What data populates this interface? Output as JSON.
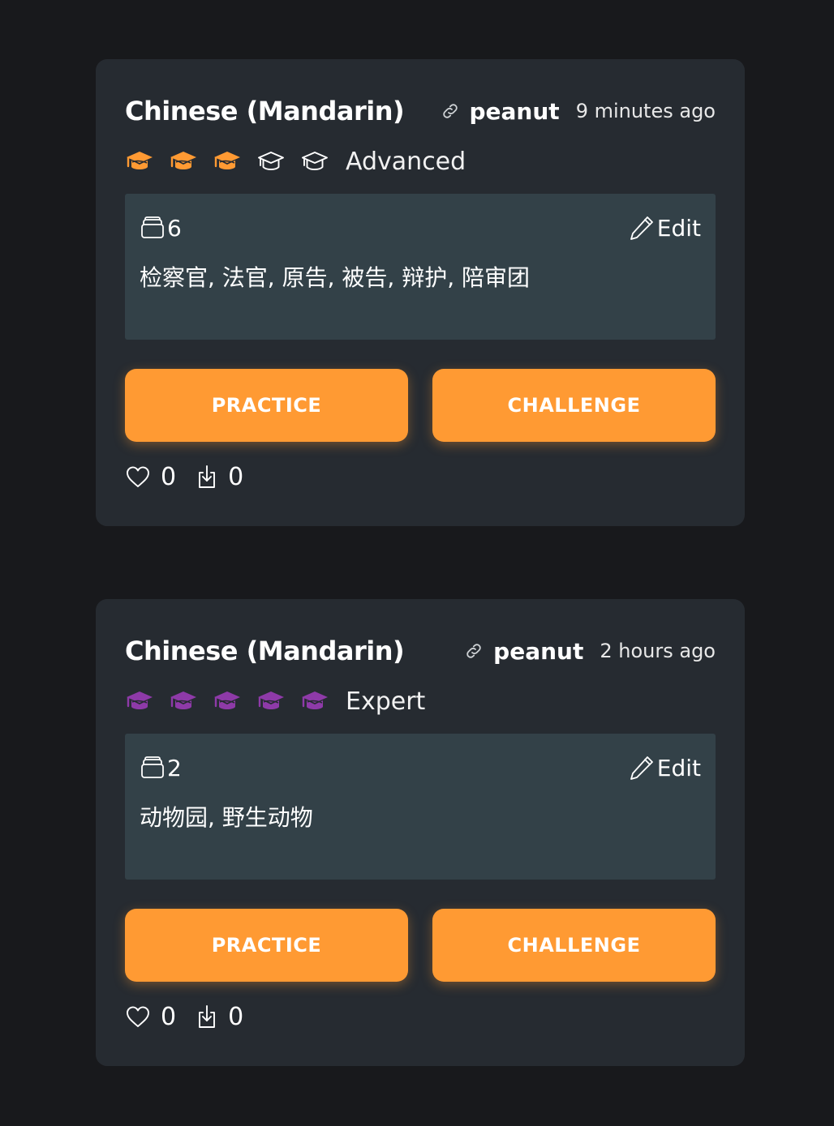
{
  "colors": {
    "background": "#18191c",
    "card": "#262b31",
    "words_panel": "#334148",
    "accent_orange": "#ff9a33",
    "expert_purple": "#8e3aa8"
  },
  "cards": [
    {
      "title": "Chinese (Mandarin)",
      "link_icon": "link-icon",
      "user": "peanut",
      "time": "9 minutes ago",
      "level": {
        "label": "Advanced",
        "filled": 3,
        "total": 5,
        "icon": "graduation-cap-icon",
        "color": "#ff9a33"
      },
      "word_count": "6",
      "edit_label": "Edit",
      "words": "检察官, 法官, 原告, 被告, 辩护, 陪审团",
      "practice_label": "PRACTICE",
      "challenge_label": "CHALLENGE",
      "likes": "0",
      "downloads": "0"
    },
    {
      "title": "Chinese (Mandarin)",
      "link_icon": "link-icon",
      "user": "peanut",
      "time": "2 hours ago",
      "level": {
        "label": "Expert",
        "filled": 5,
        "total": 5,
        "icon": "graduation-cap-icon",
        "color": "#8e3aa8"
      },
      "word_count": "2",
      "edit_label": "Edit",
      "words": "动物园, 野生动物",
      "practice_label": "PRACTICE",
      "challenge_label": "CHALLENGE",
      "likes": "0",
      "downloads": "0"
    }
  ]
}
